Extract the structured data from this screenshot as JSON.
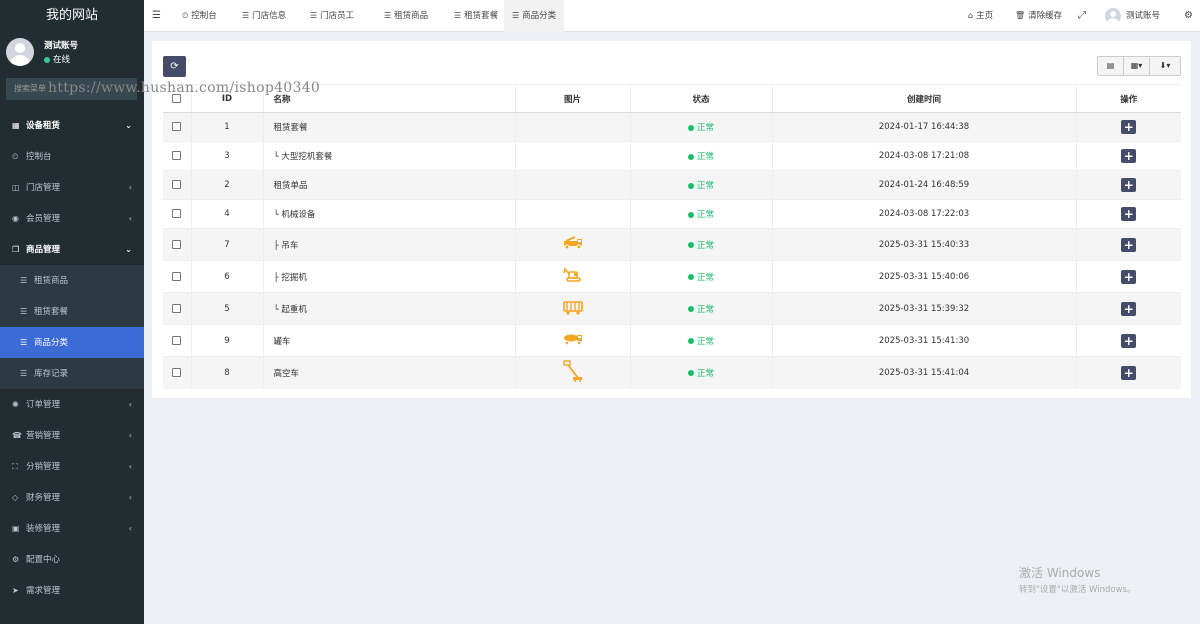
{
  "sidebar": {
    "logo": "我的网站",
    "user": {
      "name": "测试账号",
      "status": "在线"
    },
    "search_placeholder": "搜索菜单",
    "items": [
      {
        "label": "设备租赁",
        "icon": "grid-icon",
        "type": "header",
        "arrow": "⌄"
      },
      {
        "label": "控制台",
        "icon": "dashboard-icon",
        "type": "item",
        "arrow": ""
      },
      {
        "label": "门店管理",
        "icon": "columns-icon",
        "type": "item",
        "arrow": "‹"
      },
      {
        "label": "会员管理",
        "icon": "user-circle-icon",
        "type": "item",
        "arrow": "‹"
      },
      {
        "label": "商品管理",
        "icon": "clone-icon",
        "type": "header",
        "arrow": "⌄"
      },
      {
        "label": "租赁商品",
        "icon": "list-icon",
        "type": "sub",
        "arrow": ""
      },
      {
        "label": "租赁套餐",
        "icon": "list-icon",
        "type": "sub",
        "arrow": ""
      },
      {
        "label": "商品分类",
        "icon": "list-icon",
        "type": "sub-active",
        "arrow": ""
      },
      {
        "label": "库存记录",
        "icon": "list-icon",
        "type": "sub",
        "arrow": ""
      },
      {
        "label": "订单管理",
        "icon": "gear-icon",
        "type": "item",
        "arrow": "‹"
      },
      {
        "label": "营销管理",
        "icon": "bullhorn-icon",
        "type": "item",
        "arrow": "‹"
      },
      {
        "label": "分销管理",
        "icon": "sitemap-icon",
        "type": "item",
        "arrow": "‹"
      },
      {
        "label": "财务管理",
        "icon": "diamond-icon",
        "type": "item",
        "arrow": "‹"
      },
      {
        "label": "装修管理",
        "icon": "window-icon",
        "type": "item",
        "arrow": "‹"
      },
      {
        "label": "配置中心",
        "icon": "cog-icon",
        "type": "item",
        "arrow": ""
      },
      {
        "label": "需求管理",
        "icon": "send-icon",
        "type": "item",
        "arrow": ""
      }
    ]
  },
  "watermark": "https://www.hushan.com/ishop40340",
  "topbar": {
    "tabs": [
      {
        "label": "控制台",
        "icon": "dashboard-icon",
        "glyph": "⏲"
      },
      {
        "label": "门店信息",
        "icon": "list-icon",
        "glyph": "☰"
      },
      {
        "label": "门店员工",
        "icon": "list-icon",
        "glyph": "☰"
      },
      {
        "label": "租赁商品",
        "icon": "list-icon",
        "glyph": "☰"
      },
      {
        "label": "租赁套餐",
        "icon": "list-icon",
        "glyph": "☰"
      },
      {
        "label": "商品分类",
        "icon": "list-icon",
        "glyph": "☰"
      }
    ],
    "home": "主页",
    "clear_cache": "清除缓存",
    "account": "测试账号"
  },
  "table": {
    "columns": [
      "",
      "ID",
      "名称",
      "图片",
      "状态",
      "创建时间",
      "操作"
    ],
    "rows": [
      {
        "id": "1",
        "name": "租赁套餐",
        "image": "",
        "status": "正常",
        "created": "2024-01-17 16:44:38"
      },
      {
        "id": "3",
        "name": "└ 大型挖机套餐",
        "image": "",
        "status": "正常",
        "created": "2024-03-08 17:21:08"
      },
      {
        "id": "2",
        "name": "租赁单品",
        "image": "",
        "status": "正常",
        "created": "2024-01-24 16:48:59"
      },
      {
        "id": "4",
        "name": "└ 机械设备",
        "image": "",
        "status": "正常",
        "created": "2024-03-08 17:22:03"
      },
      {
        "id": "7",
        "name": "├ 吊车",
        "image": "crane-truck-icon",
        "status": "正常",
        "created": "2025-03-31 15:40:33"
      },
      {
        "id": "6",
        "name": "├ 挖掘机",
        "image": "excavator-icon",
        "status": "正常",
        "created": "2025-03-31 15:40:06"
      },
      {
        "id": "5",
        "name": "└ 起重机",
        "image": "lift-icon",
        "status": "正常",
        "created": "2025-03-31 15:39:32"
      },
      {
        "id": "9",
        "name": "罐车",
        "image": "tank-truck-icon",
        "status": "正常",
        "created": "2025-03-31 15:41:30"
      },
      {
        "id": "8",
        "name": "高空车",
        "image": "aerial-lift-icon",
        "status": "正常",
        "created": "2025-03-31 15:41:04"
      }
    ]
  },
  "windows_activation": {
    "line1": "激活 Windows",
    "line2": "转到\"设置\"以激活 Windows。"
  },
  "colors": {
    "accent": "#3c6bd5",
    "status_green": "#19be6b",
    "button_dark": "#444c69",
    "sidebar_bg": "#222d32",
    "icon_orange": "#f5a623"
  }
}
